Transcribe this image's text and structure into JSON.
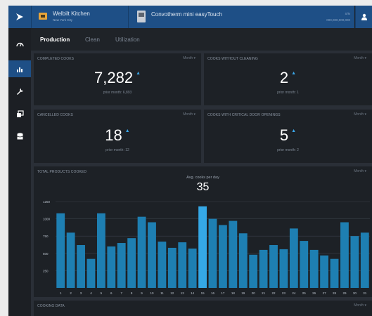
{
  "header": {
    "site_name": "Welbilt Kitchen",
    "site_city": "New York City",
    "device_name": "Convotherm mini easyTouch",
    "sn_label": "S/N",
    "sn_value": "000,000,000,000"
  },
  "tabs": [
    {
      "label": "Production"
    },
    {
      "label": "Clean"
    },
    {
      "label": "Utilization"
    }
  ],
  "cards": {
    "completed": {
      "title": "Completed Cooks",
      "period": "Month ▾",
      "value": "7,282",
      "trend": "▲",
      "prior": "prior month: 6,893"
    },
    "without_cleaning": {
      "title": "Cooks without cleaning",
      "period": "Month ▾",
      "value": "2",
      "trend": "▲",
      "prior": "prior month: 1"
    },
    "cancelled": {
      "title": "Cancelled Cooks",
      "period": "Month ▾",
      "value": "18",
      "trend": "▲",
      "prior": "prior month: 12"
    },
    "door_openings": {
      "title": "Cooks with critical door openings",
      "period": "Month ▾",
      "value": "5",
      "trend": "▲",
      "prior": "prior month: 2"
    }
  },
  "products_panel": {
    "title": "Total Products Cooked",
    "period": "Month ▾",
    "avg_label": "Avg. cooks per day",
    "avg_value": "35"
  },
  "cooking_data_panel": {
    "title": "Cooking Data",
    "period": "Month ▾"
  },
  "colors": {
    "bar": "#1e7fb2",
    "bar_highlight": "#35a8e6",
    "accent": "#1e4f86"
  },
  "icons": {
    "logo": "play-logo-icon",
    "sidebar": [
      "dashboard-gauge-icon",
      "bar-chart-icon",
      "wrench-icon",
      "devices-icon",
      "database-icon"
    ],
    "user": "user-icon"
  },
  "chart_data": {
    "type": "bar",
    "title": "Total Products Cooked",
    "xlabel": "",
    "ylabel": "",
    "categories": [
      "1",
      "2",
      "3",
      "4",
      "5",
      "6",
      "7",
      "8",
      "9",
      "10",
      "11",
      "12",
      "13",
      "14",
      "15",
      "16",
      "17",
      "18",
      "19",
      "20",
      "21",
      "22",
      "23",
      "24",
      "25",
      "26",
      "27",
      "28",
      "29",
      "30",
      "31"
    ],
    "values": [
      1080,
      800,
      620,
      420,
      1080,
      600,
      650,
      720,
      1030,
      950,
      670,
      580,
      660,
      570,
      1180,
      1000,
      910,
      970,
      790,
      480,
      550,
      620,
      560,
      860,
      680,
      550,
      470,
      420,
      950,
      750,
      800
    ],
    "highlight_index": 14,
    "yticks": [
      1250,
      1000,
      750,
      500,
      250
    ],
    "ylim": [
      0,
      1250
    ],
    "grid": true
  }
}
